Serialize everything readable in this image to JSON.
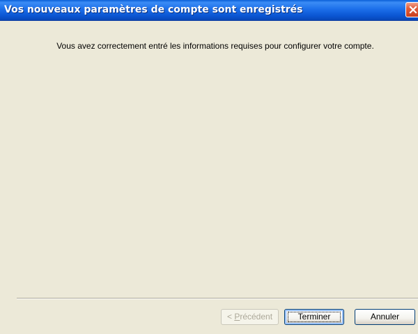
{
  "window": {
    "title": "Vos nouveaux paramètres de compte sont enregistrés"
  },
  "main": {
    "message": "Vous avez correctement entré les informations requises pour configurer votre compte."
  },
  "buttons": {
    "previous": {
      "accel": "P",
      "rest": "récédent",
      "prefix": "< ",
      "enabled": false
    },
    "finish": {
      "label": "Terminer",
      "focused": true
    },
    "cancel": {
      "label": "Annuler"
    }
  },
  "colors": {
    "titlebar": "#0a54d1",
    "dialog_background": "#ece9d8",
    "close_button": "#e05d3a"
  },
  "icons": {
    "close": "close-icon"
  }
}
